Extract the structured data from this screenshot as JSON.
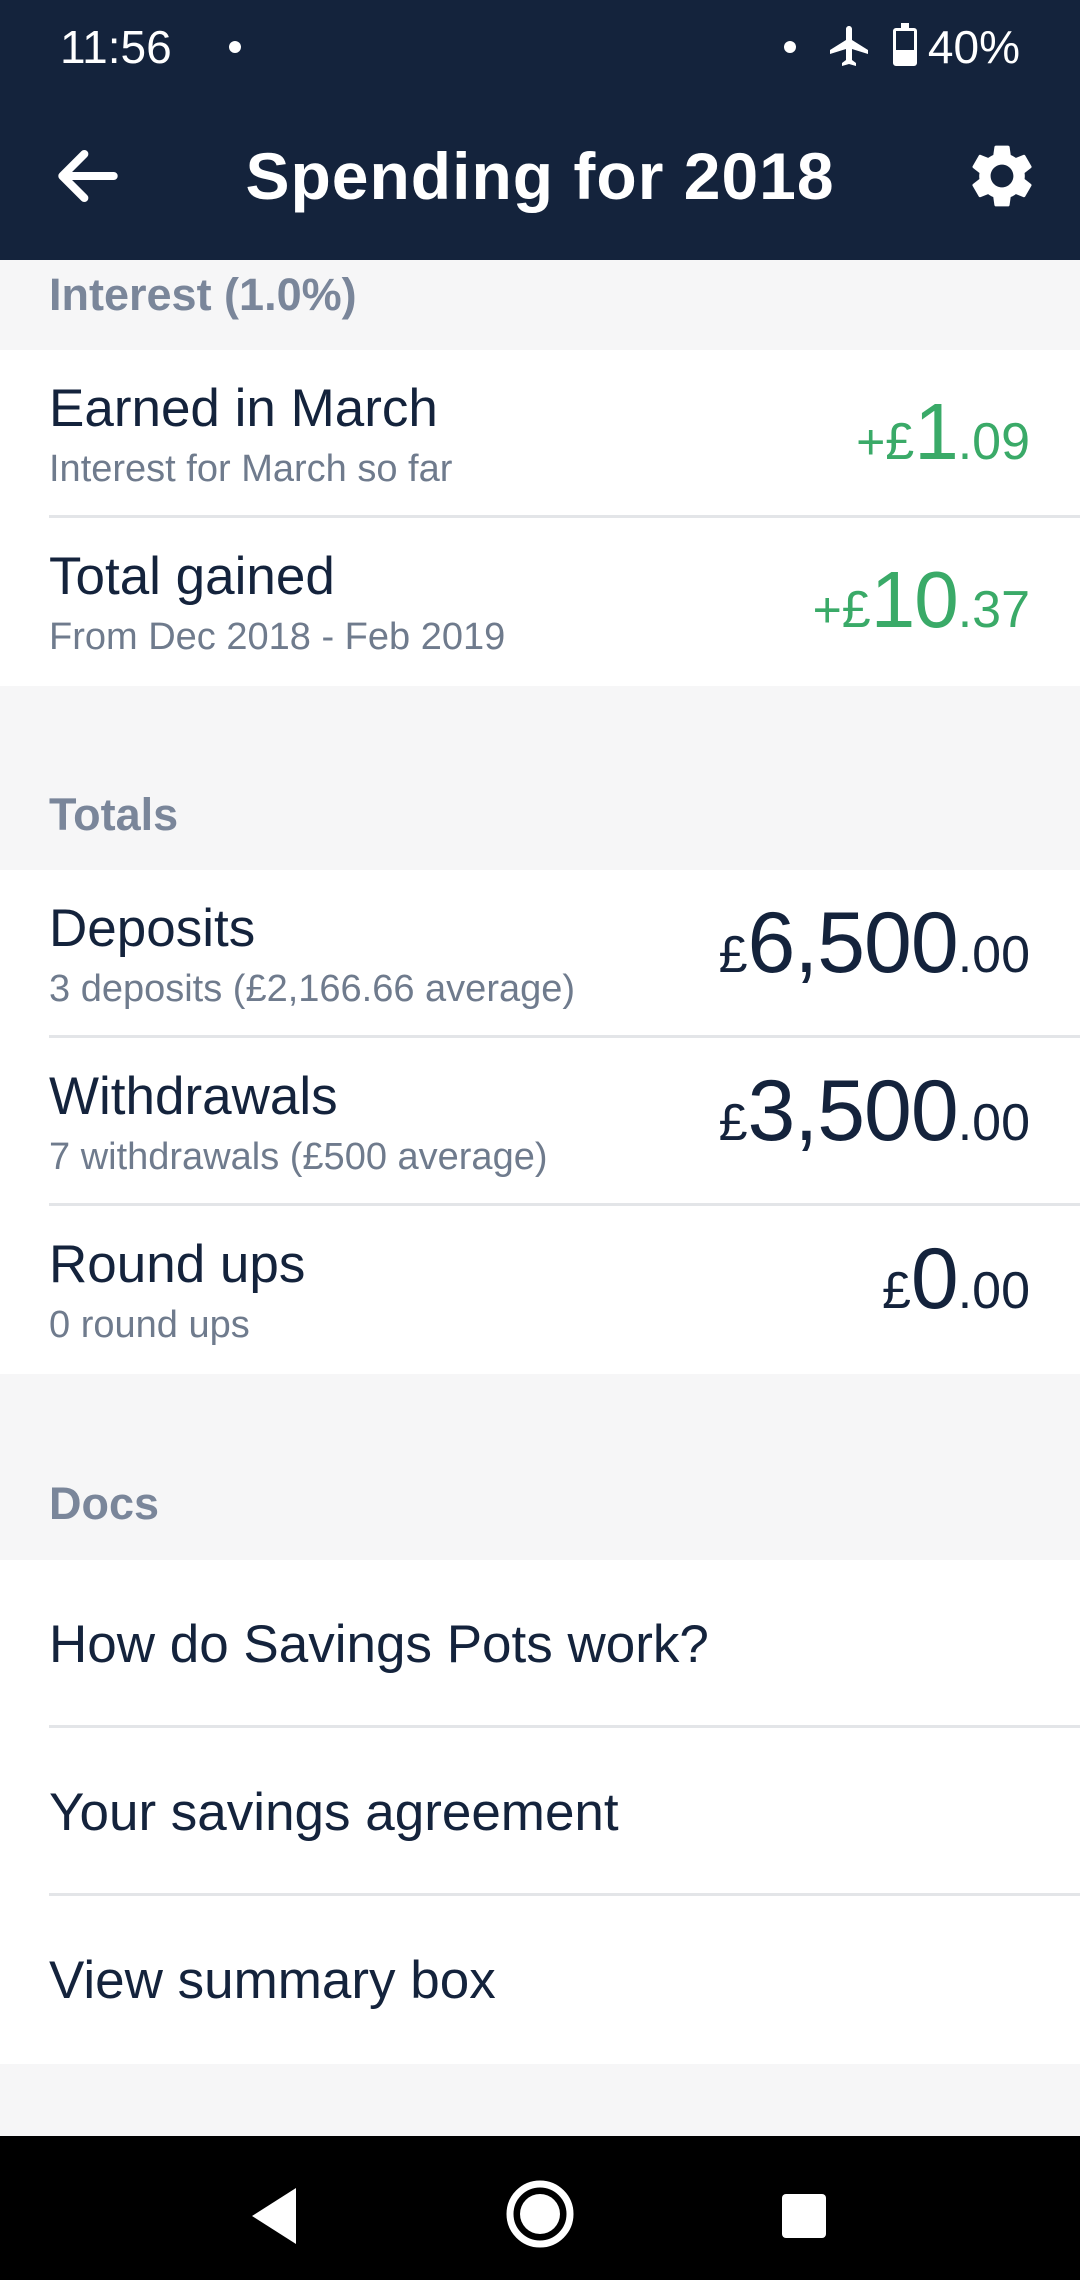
{
  "status_bar": {
    "time": "11:56",
    "battery": "40%",
    "battery_level": 0.4,
    "icons": [
      "notification-dot-icon",
      "airplane-mode-icon",
      "battery-icon"
    ]
  },
  "app_bar": {
    "title": "Spending for 2018",
    "back_icon": "arrow-left-icon",
    "settings_icon": "gear-icon"
  },
  "interest": {
    "header": "Interest (1.0%)",
    "rows": [
      {
        "title": "Earned in March",
        "subtitle": "Interest for March so far",
        "sign": "+ ",
        "currency": "£",
        "major": "1",
        "minor": ".09",
        "color": "#3aaa68"
      },
      {
        "title": "Total gained",
        "subtitle": "From Dec 2018 - Feb 2019",
        "sign": "+ ",
        "currency": "£",
        "major": "10",
        "minor": ".37",
        "color": "#3aaa68"
      }
    ]
  },
  "totals": {
    "header": "Totals",
    "rows": [
      {
        "title": "Deposits",
        "subtitle": "3 deposits (£2,166.66 average)",
        "currency": "£",
        "major": "6,500",
        "minor": ".00"
      },
      {
        "title": "Withdrawals",
        "subtitle": "7 withdrawals (£500 average)",
        "currency": "£",
        "major": "3,500",
        "minor": ".00"
      },
      {
        "title": "Round ups",
        "subtitle": "0 round ups",
        "currency": "£",
        "major": "0",
        "minor": ".00"
      }
    ]
  },
  "docs": {
    "header": "Docs",
    "items": [
      "How do Savings Pots work?",
      "Your savings agreement",
      "View summary box"
    ]
  },
  "colors": {
    "header_background": "#14233c",
    "positive_amount": "#3aaa68",
    "section_text": "#7a869a",
    "page_background": "#f6f6f7"
  },
  "nav_bar": {
    "icons": [
      "back-triangle-icon",
      "home-circle-icon",
      "recents-square-icon"
    ]
  }
}
